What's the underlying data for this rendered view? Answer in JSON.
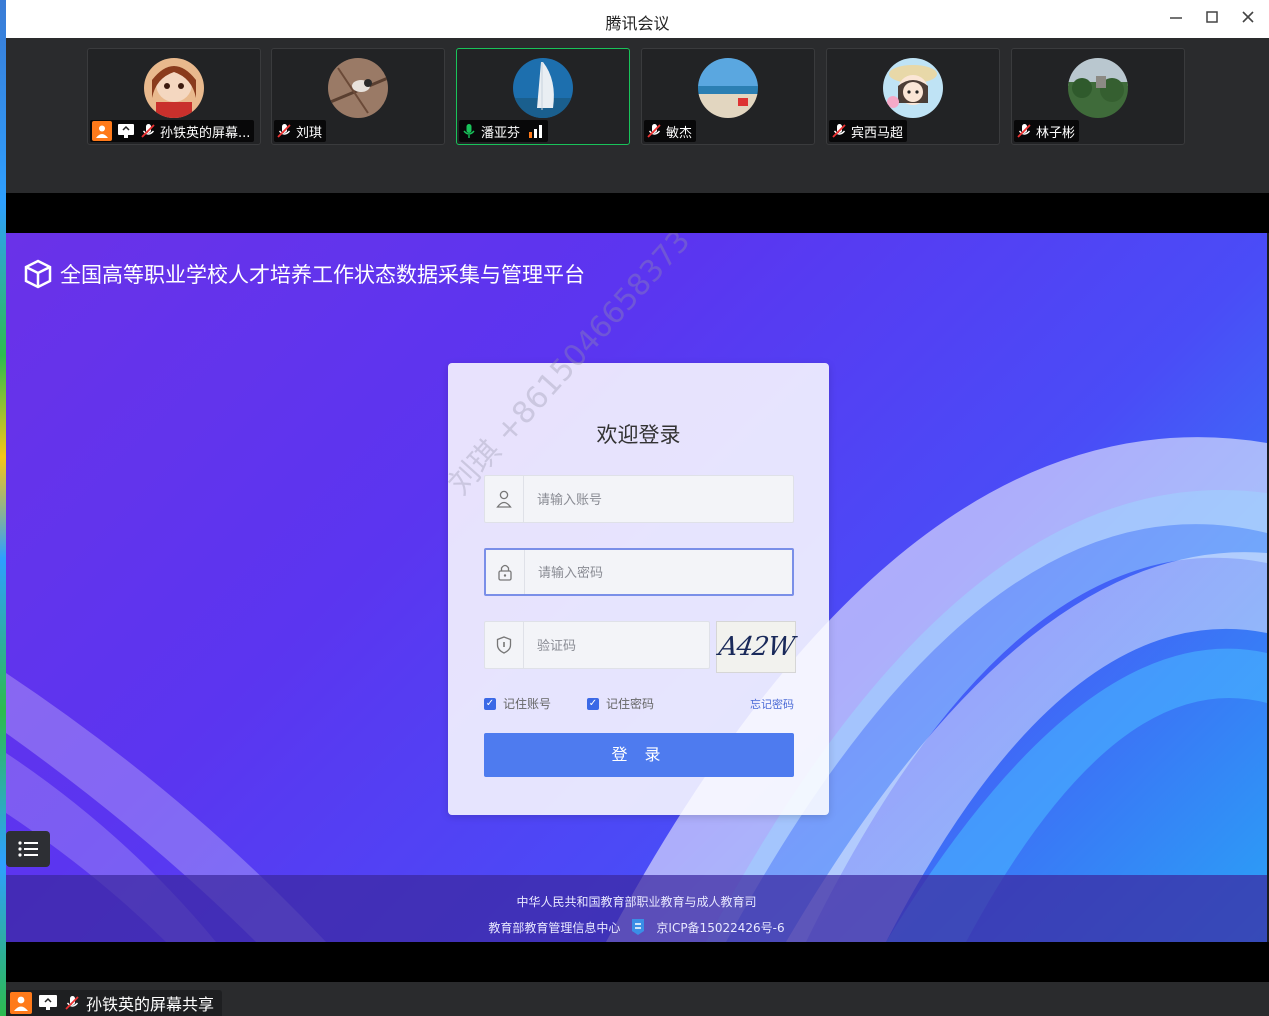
{
  "window": {
    "title": "腾讯会议",
    "minimize_icon": "minimize-icon",
    "maximize_icon": "maximize-icon",
    "close_icon": "close-icon"
  },
  "participants": [
    {
      "name": "孙铁英的屏幕...",
      "avatar": "anime-girl-avatar",
      "speaking": false,
      "sharing": true
    },
    {
      "name": "刘琪",
      "avatar": "bird-branch-avatar",
      "speaking": false,
      "sharing": false
    },
    {
      "name": "潘亚芬",
      "avatar": "burj-al-arab-avatar",
      "speaking": true,
      "sharing": false
    },
    {
      "name": "敏杰",
      "avatar": "beach-avatar",
      "speaking": false,
      "sharing": false
    },
    {
      "name": "宾西马超",
      "avatar": "cartoon-girl-avatar",
      "speaking": false,
      "sharing": false
    },
    {
      "name": "林子彬",
      "avatar": "landscape-avatar",
      "speaking": false,
      "sharing": false
    }
  ],
  "shared_page": {
    "system_title": "全国高等职业学校人才培养工作状态数据采集与管理平台",
    "login": {
      "title": "欢迎登录",
      "account_placeholder": "请输入账号",
      "password_placeholder": "请输入密码",
      "captcha_placeholder": "验证码",
      "captcha_text": "A42W",
      "remember_account": "记住账号",
      "remember_password": "记住密码",
      "forgot_password": "忘记密码",
      "login_button": "登 录"
    },
    "watermark": "刘琪 +8615046658373",
    "footer": {
      "line1": "中华人民共和国教育部职业教育与成人教育司",
      "line2_left": "教育部教育管理信息中心",
      "line2_right": "京ICP备15022426号-6"
    }
  },
  "sharer_label": "孙铁英的屏幕共享",
  "colors": {
    "accent_green": "#19c35a",
    "login_button": "#4e7bef",
    "stage_gradient_start": "#6a32e8",
    "stage_gradient_end": "#2aa2f6"
  }
}
